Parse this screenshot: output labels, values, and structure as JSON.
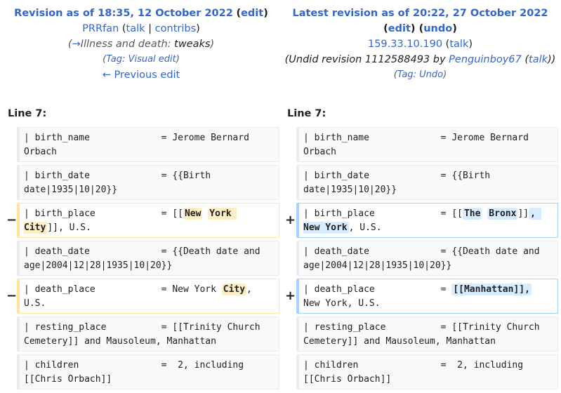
{
  "left_header": {
    "revision_title": "Revision as of 18:35, 12 October 2022",
    "edit": "edit",
    "user": "PRRfan",
    "talk": "talk",
    "contribs": "contribs",
    "summary_section": "Illness and death:",
    "summary_text": "tweaks",
    "tag_label": "Tag:",
    "tag_value": "Visual edit",
    "prev_edit": "← Previous edit"
  },
  "right_header": {
    "revision_title": "Latest revision as of 20:22, 27 October 2022",
    "edit": "edit",
    "undo": "undo",
    "user_ip": "159.33.10.190",
    "talk": "talk",
    "undid_prefix": "(Undid revision 1112588493 by",
    "undid_user": "Penguinboy67",
    "undid_talk": "talk",
    "tag_label": "Tag:",
    "tag_value": "Undo"
  },
  "left_line": "Line 7:",
  "right_line": "Line 7:",
  "rows": [
    {
      "left": "| birth_name             = Jerome Bernard Orbach",
      "right": "| birth_name             = Jerome Bernard Orbach"
    },
    {
      "left": "| birth_date             = {{Birth date|1935|10|20}}",
      "right": "| birth_date             = {{Birth date|1935|10|20}}"
    },
    {
      "left_pre": "| birth_place            = [[",
      "left_h1": "New",
      "left_h2": "York City",
      "left_post": "]], U.S.",
      "right_pre": "| birth_place            = [[",
      "right_h1": "The",
      "right_h2": "Bronx",
      "right_mid": "]]",
      "right_h3": ", New York",
      "right_post": ", U.S."
    },
    {
      "left": "| death_date             = {{Death date and age|2004|12|28|1935|10|20}}",
      "right": "| death_date             = {{Death date and age|2004|12|28|1935|10|20}}"
    },
    {
      "left_pre": "| death_place            = New York",
      "left_h1": "City",
      "left_post": ", U.S.",
      "right_pre": "| death_place            =",
      "right_h1": "[[Manhattan]],",
      "right_post": " New York, U.S."
    },
    {
      "left": "| resting_place          = [[Trinity Church Cemetery]] and Mausoleum, Manhattan",
      "right": "| resting_place          = [[Trinity Church Cemetery]] and Mausoleum, Manhattan"
    },
    {
      "left": "| children               =  2, including [[Chris Orbach]]",
      "right": "| children               =  2, including [[Chris Orbach]]"
    }
  ],
  "markers": {
    "minus": "−",
    "plus": "+"
  }
}
